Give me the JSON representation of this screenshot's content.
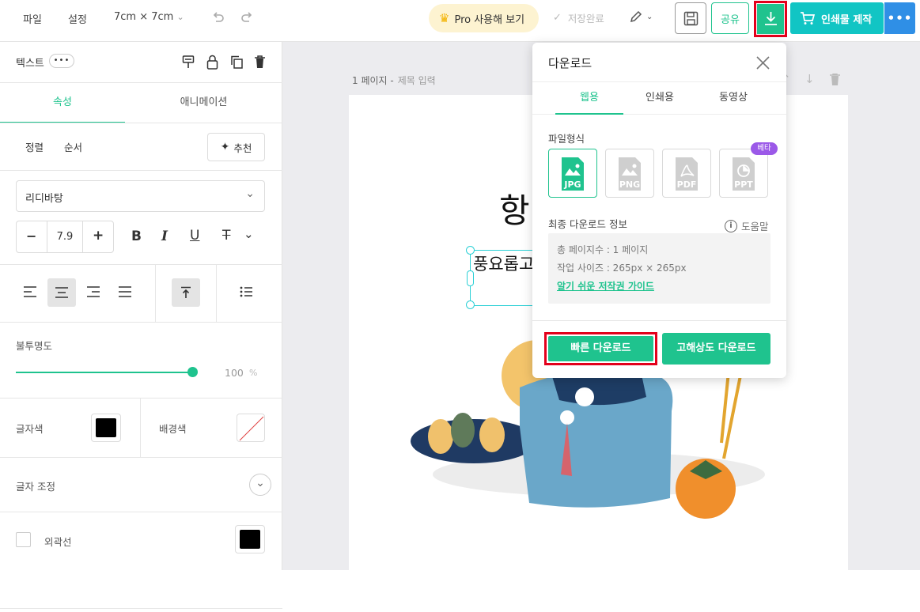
{
  "topbar": {
    "menu": [
      "파일",
      "설정"
    ],
    "size": "7cm × 7cm",
    "pro_label": "Pro 사용해 보기",
    "saved_label": "저장완료",
    "share_label": "공유",
    "print_label": "인쇄물 제작"
  },
  "sidebar": {
    "header": "텍스트",
    "tabs": [
      "속성",
      "애니메이션"
    ],
    "sub_tabs": [
      "정렬",
      "순서"
    ],
    "recommend_label": "추천",
    "font": "리디바탕",
    "font_size": "7.9",
    "opacity_label": "불투명도",
    "opacity_value": "100",
    "opacity_unit": "%",
    "opacity_fraction": 1.0,
    "text_color_label": "글자색",
    "bg_color_label": "배경색",
    "adjust_label": "글자 조정",
    "outline_label": "외곽선"
  },
  "canvas": {
    "page_label": "1 페이지 -",
    "page_title_placeholder": "제목 입력",
    "heading_partial": "항",
    "text_partial": "풍요롭고"
  },
  "download": {
    "title": "다운로드",
    "tabs": [
      "웹용",
      "인쇄용",
      "동영상"
    ],
    "format_label": "파일형식",
    "formats": [
      "JPG",
      "PNG",
      "PDF",
      "PPT"
    ],
    "beta": "베타",
    "info_label": "최종 다운로드 정보",
    "help_label": "도움말",
    "pages": "총 페이지수 : 1 페이지",
    "work_size": "작업 사이즈 : 265px × 265px",
    "guide_link": "알기 쉬운 저작권 가이드",
    "quick_label": "빠른 다운로드",
    "hires_label": "고해상도 다운로드"
  },
  "colors": {
    "accent": "#1fc38e",
    "teal": "#11c5c4",
    "blue": "#2f8fe6",
    "highlight": "#e3001b"
  }
}
